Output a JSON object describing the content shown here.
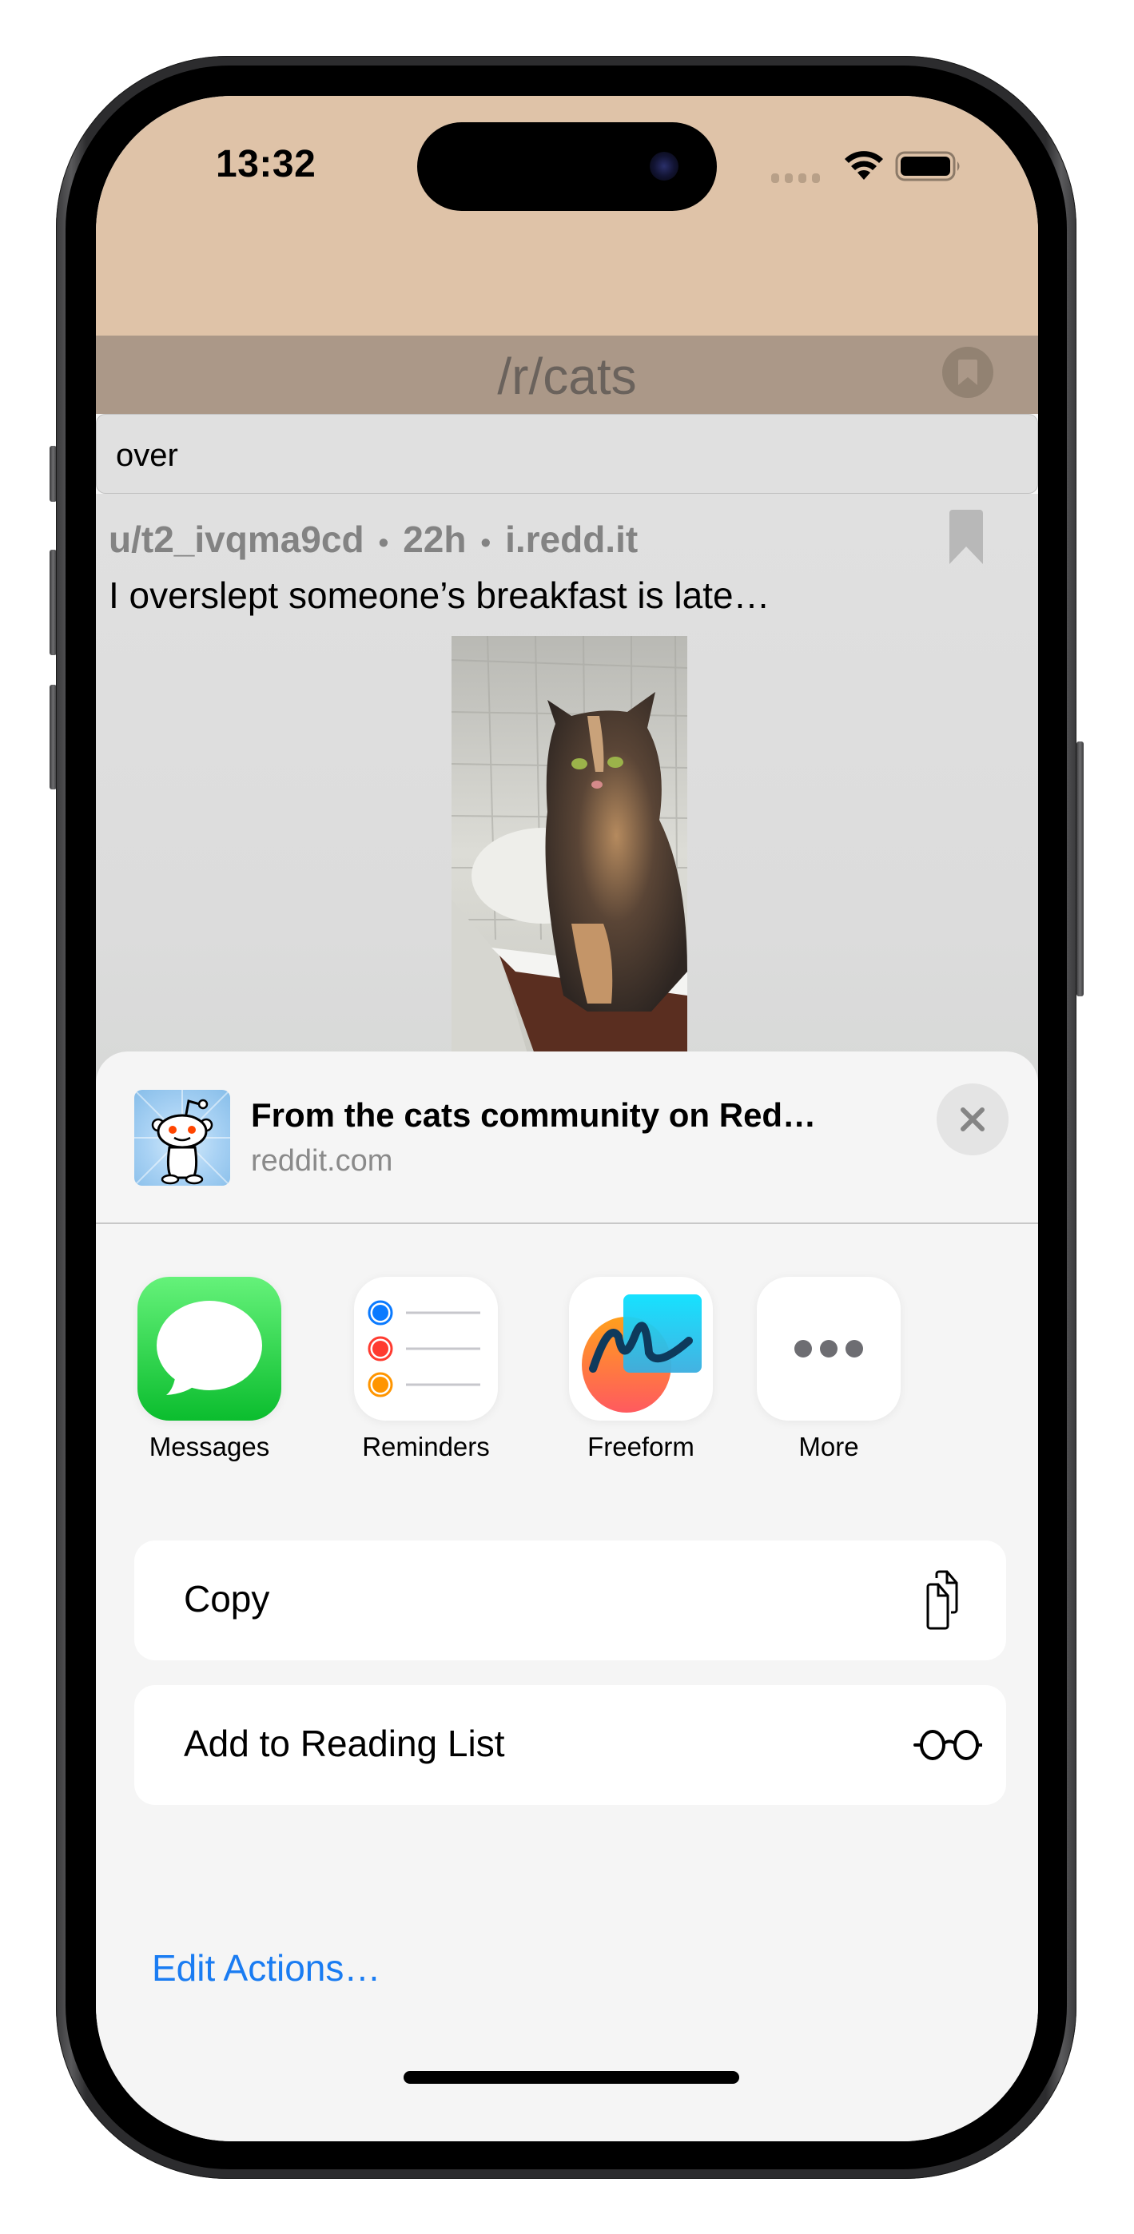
{
  "status_bar": {
    "time": "13:32",
    "icons": [
      "cellular-signal-icon",
      "wifi-icon",
      "battery-icon"
    ]
  },
  "nav": {
    "title": "/r/cats",
    "bookmark_icon": "bookmark-circle-icon"
  },
  "search": {
    "value": "over",
    "placeholder": ""
  },
  "post": {
    "author": "u/t2_ivqma9cd",
    "separator": "•",
    "age": "22h",
    "domain": "i.redd.it",
    "title": "I overslept someone’s breakfast is late…",
    "image_alt": "Tortoiseshell cat sitting on a bathroom sink",
    "bookmark_icon": "bookmark-icon"
  },
  "share_sheet": {
    "preview": {
      "icon": "reddit-alien-icon",
      "title": "From the cats community on Red…",
      "subtitle": "reddit.com"
    },
    "close_icon": "close-icon",
    "apps": [
      {
        "label": "Messages",
        "icon": "messages-app-icon"
      },
      {
        "label": "Reminders",
        "icon": "reminders-app-icon"
      },
      {
        "label": "Freeform",
        "icon": "freeform-app-icon"
      },
      {
        "label": "More",
        "icon": "more-icon"
      }
    ],
    "actions": [
      {
        "label": "Copy",
        "icon": "copy-icon"
      },
      {
        "label": "Add to Reading List",
        "icon": "reading-list-glasses-icon"
      }
    ],
    "edit_actions": "Edit Actions…"
  },
  "colors": {
    "header_tan": "#dfc3a8",
    "nav_bar": "#ab9888",
    "link_blue": "#1a7cf2",
    "messages_green": "#34c759"
  }
}
